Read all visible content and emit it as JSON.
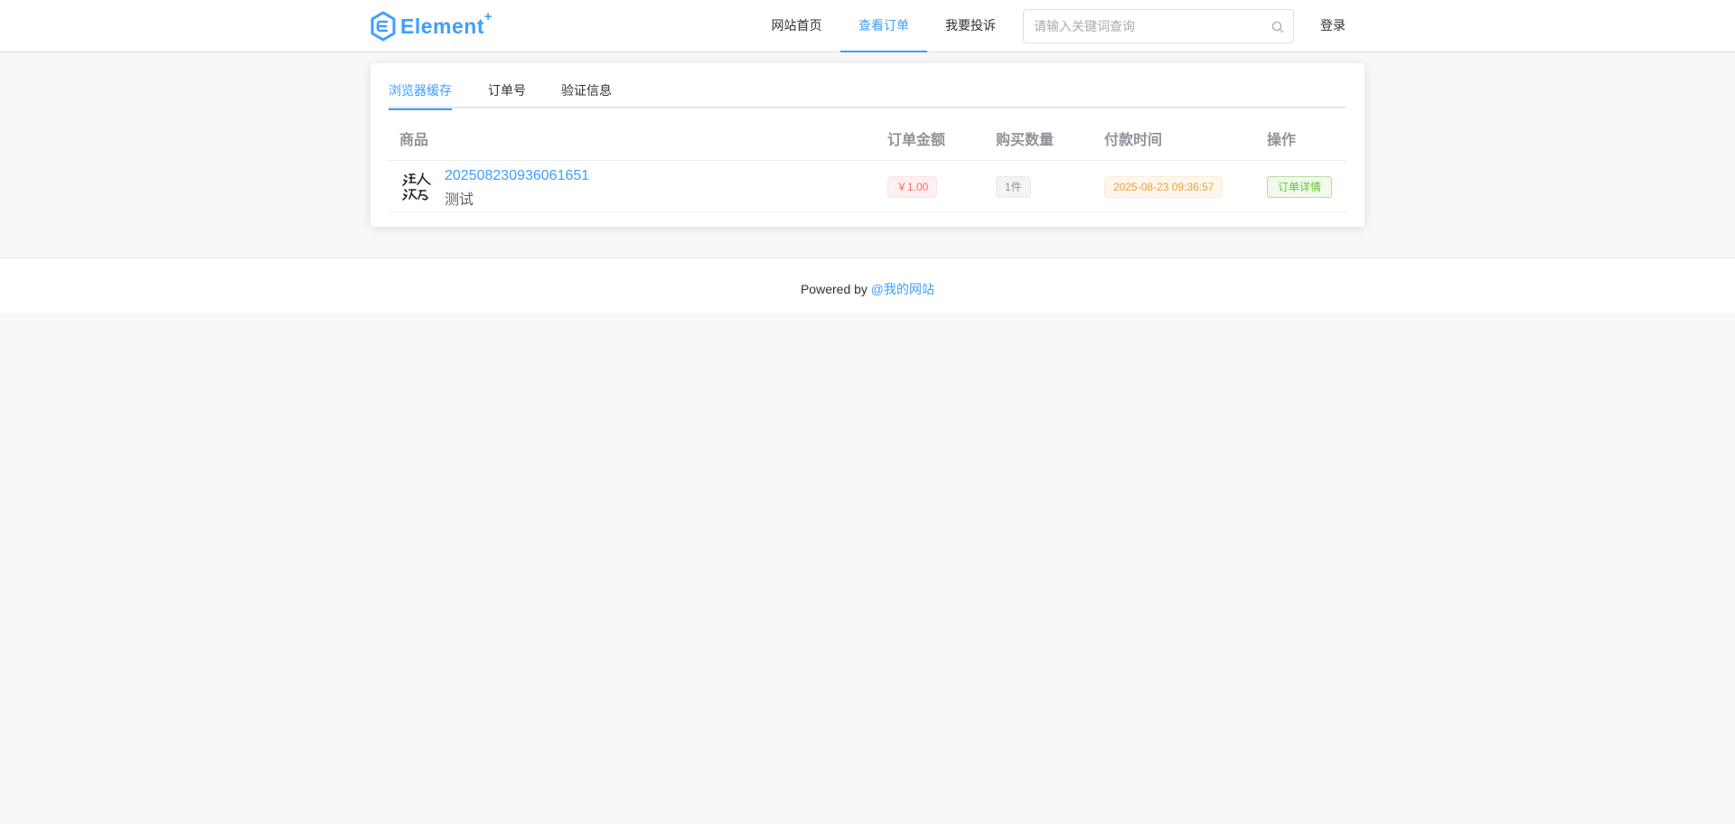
{
  "header": {
    "logo_text": "Element",
    "logo_plus": "+",
    "nav": [
      {
        "label": "网站首页"
      },
      {
        "label": "查看订单"
      },
      {
        "label": "我要投诉"
      }
    ],
    "search_placeholder": "请输入关键词查询",
    "login_label": "登录"
  },
  "tabs": [
    {
      "label": "浏览器缓存"
    },
    {
      "label": "订单号"
    },
    {
      "label": "验证信息"
    }
  ],
  "table": {
    "headers": {
      "product": "商品",
      "amount": "订单金额",
      "qty": "购买数量",
      "time": "付款时间",
      "action": "操作"
    },
    "rows": [
      {
        "order_no": "202508230936061651",
        "product_name": "测试",
        "amount": "￥1.00",
        "qty": "1件",
        "paid_time": "2025-08-23 09:36:57",
        "action_label": "订单详情"
      }
    ]
  },
  "footer": {
    "powered_by": "Powered by",
    "site_link": "@我的网站"
  },
  "colors": {
    "accent": "#409eff",
    "danger": "#f56c6c",
    "warning": "#e6a23c",
    "success": "#67c23a",
    "page_bg": "#f8f8f8"
  }
}
